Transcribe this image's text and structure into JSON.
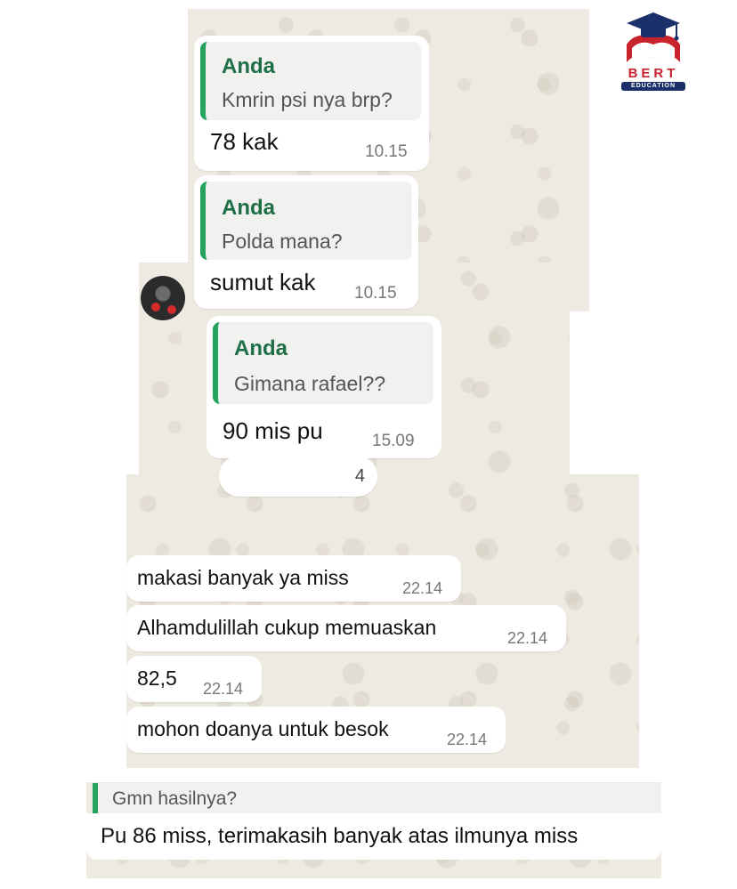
{
  "logo": {
    "brand": "BERT",
    "sub": "EDUCATION",
    "brand_color": "#c8232c",
    "navy": "#1b2f6b"
  },
  "chat1": {
    "bubbles": [
      {
        "quote_author": "Anda",
        "quote_text": "Kmrin psi nya brp?",
        "text": "78 kak",
        "time": "10.15"
      },
      {
        "quote_author": "Anda",
        "quote_text": "Polda mana?",
        "text": "sumut kak",
        "time": "10.15"
      }
    ]
  },
  "chat2": {
    "bubble": {
      "quote_author": "Anda",
      "quote_text": "Gimana rafael??",
      "text": "90 mis pu",
      "time": "15.09"
    },
    "counter": "4"
  },
  "chat3": {
    "messages": [
      {
        "text": "makasi banyak ya miss",
        "time": "22.14"
      },
      {
        "text": "Alhamdulillah cukup memuaskan",
        "time": "22.14"
      },
      {
        "text": "82,5",
        "time": "22.14"
      },
      {
        "text": "mohon doanya untuk besok",
        "time": "22.14"
      }
    ]
  },
  "chat4": {
    "quote_text": "Gmn hasilnya?",
    "text": "Pu 86 miss, terimakasih banyak atas ilmunya miss"
  },
  "colors": {
    "quote_bar": "#25a35f",
    "quote_author": "#1e6f45",
    "chat_bg": "#eeeae2"
  }
}
